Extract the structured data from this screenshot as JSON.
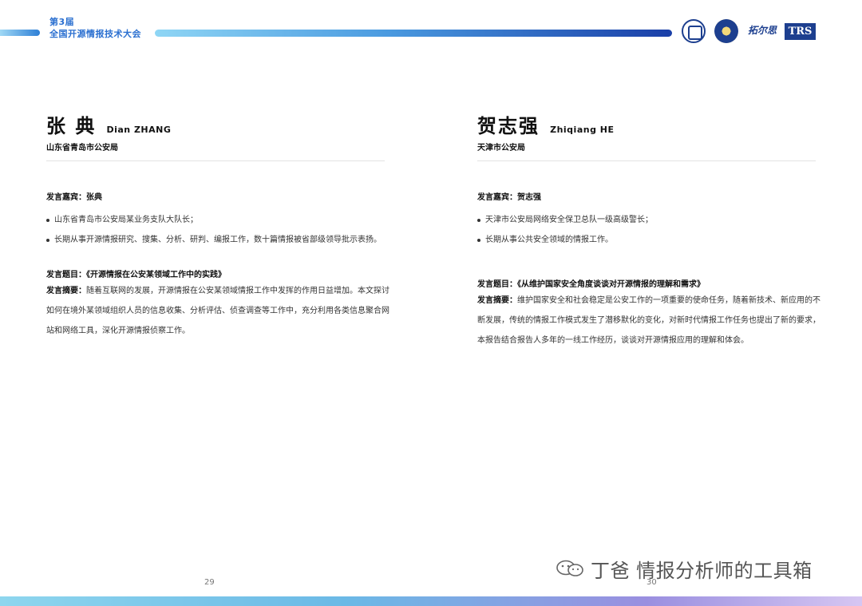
{
  "header": {
    "edition": "第3届",
    "conference": "全国开源情报技术大会",
    "logos": [
      "university-seal-icon",
      "police-emblem-icon",
      "calligraphy-logo-icon"
    ],
    "logo_trs": "TRS",
    "logo_calligraphy": "拓尔思"
  },
  "speakers": [
    {
      "cn_name": "张 典",
      "en_name": "Dian ZHANG",
      "org": "山东省青岛市公安局",
      "guest_label": "发言嘉宾：",
      "guest_name": "张典",
      "bullets": [
        "山东省青岛市公安局某业务支队大队长；",
        "长期从事开源情报研究、搜集、分析、研判、编报工作，数十篇情报被省部级领导批示表扬。"
      ],
      "topic_label": "发言题目：",
      "topic": "《开源情报在公安某领域工作中的实践》",
      "abstract_label": "发言摘要：",
      "abstract": "随着互联网的发展，开源情报在公安某领域情报工作中发挥的作用日益增加。本文探讨如何在境外某领域组织人员的信息收集、分析评估、侦查调查等工作中，充分利用各类信息聚合网站和网络工具，深化开源情报侦察工作。",
      "page": "29"
    },
    {
      "cn_name": "贺志强",
      "en_name": "Zhiqiang HE",
      "org": "天津市公安局",
      "guest_label": "发言嘉宾：",
      "guest_name": "贺志强",
      "bullets": [
        "天津市公安局网络安全保卫总队一级高级警长；",
        "长期从事公共安全领域的情报工作。"
      ],
      "topic_label": "发言题目：",
      "topic": "《从维护国家安全角度谈谈对开源情报的理解和需求》",
      "abstract_label": "发言摘要：",
      "abstract": "维护国家安全和社会稳定是公安工作的一项重要的使命任务，随着新技术、新应用的不断发展，传统的情报工作模式发生了潜移默化的变化，对新时代情报工作任务也提出了新的要求，本报告结合报告人多年的一线工作经历，谈谈对开源情报应用的理解和体会。",
      "page": "30"
    }
  ],
  "watermark": {
    "icon": "wechat-icon",
    "text": "丁爸 情报分析师的工具箱"
  },
  "colors": {
    "accent": "#2a6fd0",
    "brand_dark": "#1d3f8f"
  }
}
